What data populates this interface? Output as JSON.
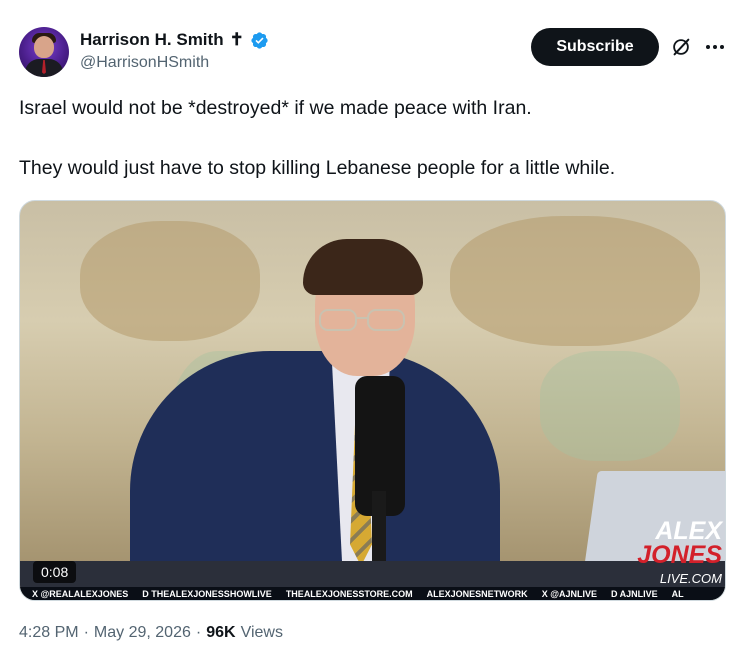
{
  "author": {
    "display_name": "Harrison H. Smith",
    "name_symbol": "✝",
    "handle": "@HarrisonHSmith",
    "verified_color": "#1d9bf0"
  },
  "actions": {
    "subscribe_label": "Subscribe",
    "grok_icon": "grok-icon",
    "more_icon": "more-icon"
  },
  "tweet": {
    "paragraphs": [
      "Israel would not be *destroyed* if we made peace with Iran.",
      "They would just have to stop killing Lebanese people for a little while."
    ]
  },
  "media": {
    "timecode": "0:08",
    "logo": {
      "line1": "ALEX",
      "line2": "JONES",
      "line3": "LIVE.COM"
    },
    "ticker": [
      "X @REALALEXJONES",
      "D THEALEXJONESSHOWLIVE",
      "THEALEXJONESSTORE.COM",
      "ALEXJONESNETWORK",
      "X @AJNLIVE",
      "D AJNLIVE",
      "AL"
    ]
  },
  "meta": {
    "time": "4:28 PM",
    "separator": "·",
    "date": "May 29, 2026",
    "views_count": "96K",
    "views_label": "Views"
  }
}
